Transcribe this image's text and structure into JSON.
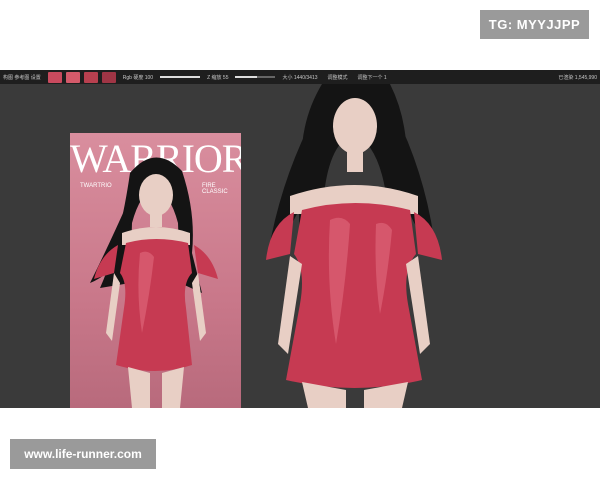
{
  "watermark_top": "TG: MYYJJPP",
  "watermark_bottom": "www.life-runner.com",
  "toolbar": {
    "left_text": "构图 参考图 设置",
    "hardness_label": "Rgb 硬度 100",
    "size_label": "Z 缩放 55",
    "canvas_size_label": "大小 1440/3413",
    "mode_label": "调整模式",
    "next_label": "调整下一个 1",
    "counter_label": "已渲染 1,545,990",
    "swatch_colors": [
      "#c94a5e",
      "#d45a6a",
      "#b8404f",
      "#a03545"
    ],
    "hardness_fraction": 1.0,
    "size_fraction": 0.55
  },
  "poster": {
    "title": "WARRIORE",
    "subtitle": "TWARTRIO",
    "side_text": "FIRE CLASSIC"
  },
  "colors": {
    "background": "#3a3a3a",
    "toolbar": "#1e1e1e",
    "poster": "#d98e9e",
    "dress": "#c63a52",
    "hair": "#141414"
  }
}
